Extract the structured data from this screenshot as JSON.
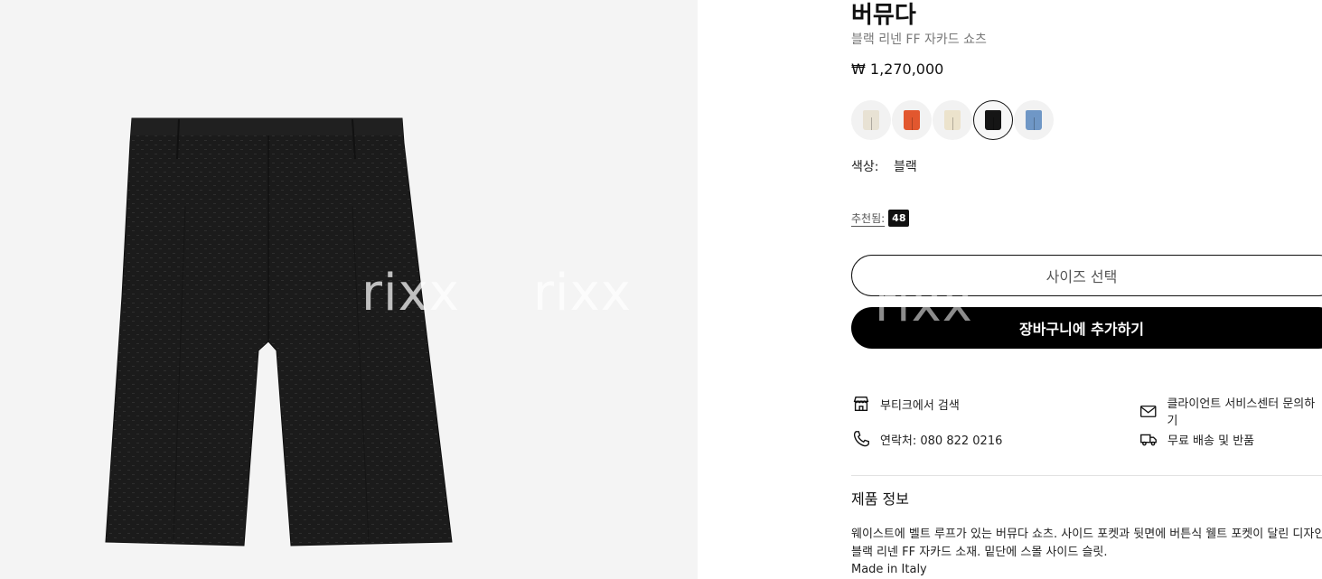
{
  "product": {
    "title": "버뮤다",
    "subtitle": "블랙 리넨 FF 자카드 쇼츠",
    "price": "₩ 1,270,000",
    "color_label": "색상:",
    "color_value": "블랙",
    "recommended_label": "추천됨:",
    "recommended_size": "48"
  },
  "swatches": [
    {
      "name": "cream",
      "color": "#e8e2d4",
      "selected": false
    },
    {
      "name": "orange",
      "color": "#e2572e",
      "selected": false
    },
    {
      "name": "beige",
      "color": "#ece3cc",
      "selected": false
    },
    {
      "name": "black",
      "color": "#151515",
      "selected": true
    },
    {
      "name": "blue",
      "color": "#6f97c6",
      "selected": false
    }
  ],
  "buttons": {
    "size_select": "사이즈 선택",
    "add_to_cart": "장바구니에 추가하기"
  },
  "services": {
    "boutique": "부티크에서 검색",
    "client_service": "클라이언트 서비스센터 문의하기",
    "contact": "연락처: 080 822 0216",
    "shipping": "무료 배송 및 반품"
  },
  "info": {
    "title": "제품 정보",
    "lines": [
      "웨이스트에 벨트 루프가 있는 버뮤다 쇼츠. 사이드 포켓과 뒷면에 버튼식 웰트 포켓이 달린 디자인.",
      "블랙 리넨 FF 자카드 소재. 밑단에 스몰 사이드 슬릿.",
      "Made in Italy"
    ]
  },
  "watermark": "rixx",
  "icons": [
    "store-icon",
    "mail-icon",
    "phone-icon",
    "delivery-truck-icon"
  ]
}
